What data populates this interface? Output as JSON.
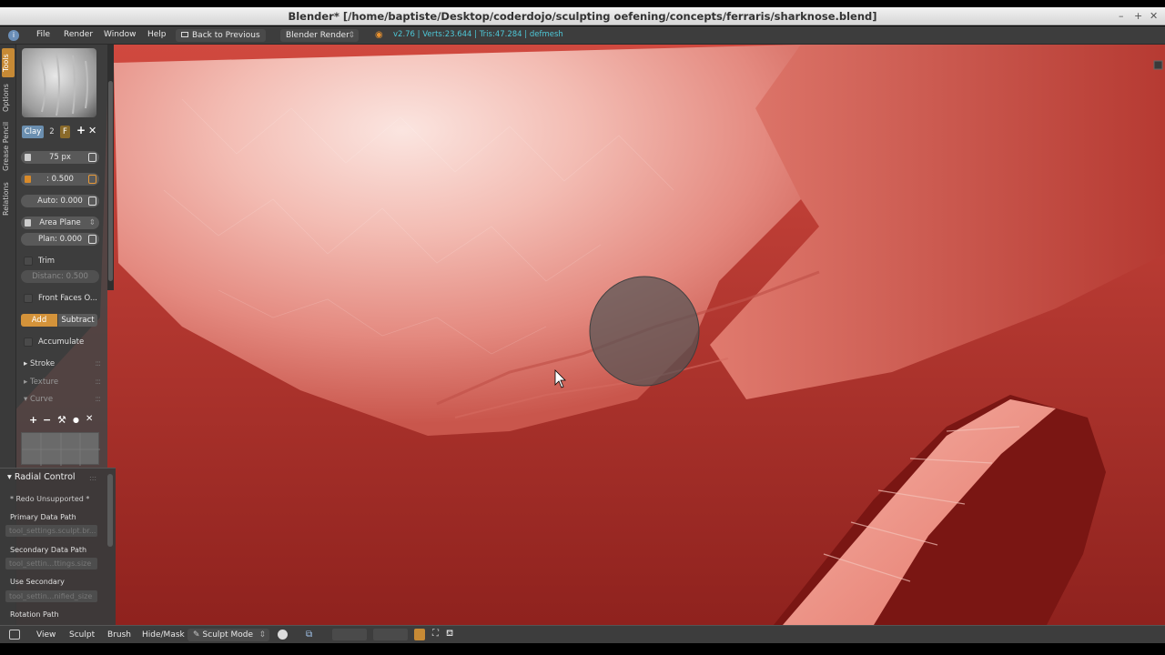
{
  "window": {
    "title": "Blender* [/home/baptiste/Desktop/coderdojo/sculpting oefening/concepts/ferraris/sharknose.blend]",
    "controls": [
      "–",
      "+",
      "✕"
    ]
  },
  "info_header": {
    "menus": [
      "File",
      "Render",
      "Window",
      "Help"
    ],
    "back_button": "Back to Previous",
    "engine": "Blender Render",
    "stats": "v2.76 | Verts:23.644 | Tris:47.284 | defmesh"
  },
  "left_tabs": [
    "Tools",
    "Options",
    "Grease Pencil",
    "Relations"
  ],
  "tool_panel": {
    "brush": {
      "name": "Clay",
      "users": "2",
      "fake_user": "F"
    },
    "radius": "75 px",
    "strength": ": 0.500",
    "autosmooth": "Auto: 0.000",
    "sculpt_plane": "Area Plane",
    "plane_offset": "Plan: 0.000",
    "trim_label": "Trim",
    "trim_distance": "Distanc: 0.500",
    "front_faces_label": "Front Faces O...",
    "direction": {
      "add": "Add",
      "subtract": "Subtract"
    },
    "accumulate_label": "Accumulate",
    "sections": [
      "Stroke",
      "Texture",
      "Curve"
    ]
  },
  "redo_panel": {
    "title": "Radial Control",
    "unsupported": "* Redo Unsupported *",
    "fields": [
      {
        "label": "Primary Data Path",
        "value": "tool_settings.sculpt.br..."
      },
      {
        "label": "Secondary Data Path",
        "value": "tool_settin...ttings.size"
      },
      {
        "label": "Use Secondary",
        "value": "tool_settin...nified_size"
      },
      {
        "label": "Rotation Path",
        "value": ""
      }
    ]
  },
  "bottom_header": {
    "menus": [
      "View",
      "Sculpt",
      "Brush",
      "Hide/Mask"
    ],
    "mode": "Sculpt Mode"
  },
  "colors": {
    "mesh_light": "#f7d3cd",
    "mesh_mid": "#e07b70",
    "mesh_dark": "#a82a24",
    "brush_cursor": "#555555",
    "ui_panel": "#464646",
    "accent": "#d88a2a",
    "stats_text": "#4ec8d8"
  }
}
